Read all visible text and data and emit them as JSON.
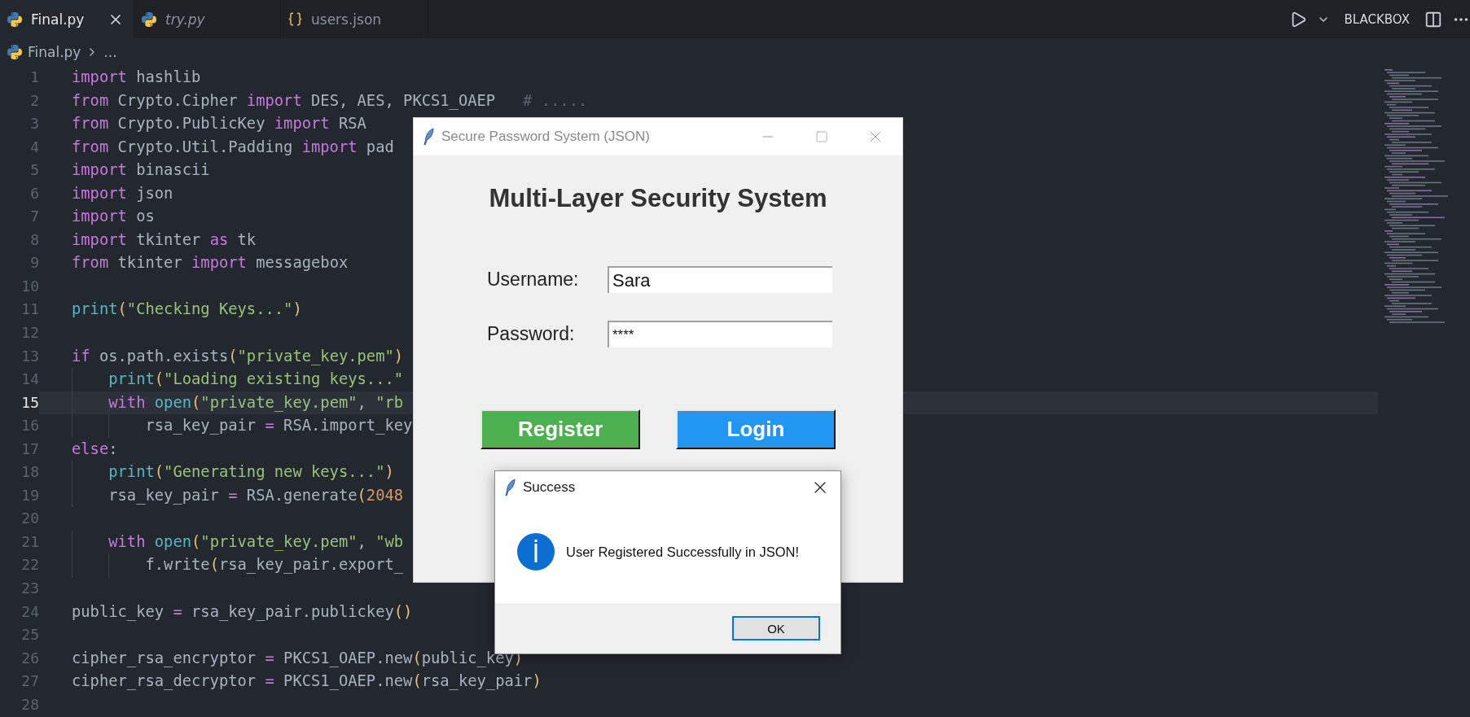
{
  "tabs": [
    {
      "label": "Final.py",
      "kind": "python",
      "selected": true,
      "preview": false
    },
    {
      "label": "try.py",
      "kind": "python",
      "selected": false,
      "preview": true
    },
    {
      "label": "users.json",
      "kind": "json",
      "selected": false,
      "preview": false
    }
  ],
  "toolbar": {
    "label": "BLACKBOX"
  },
  "breadcrumb": [
    "Final.py",
    "..."
  ],
  "editor": {
    "lines": [
      {
        "number": "1",
        "current": false,
        "tokens": [
          {
            "kind": "kw",
            "text": "import"
          },
          {
            "kind": "plain",
            "text": " hashlib"
          }
        ]
      },
      {
        "number": "2",
        "current": false,
        "tokens": [
          {
            "kind": "kw",
            "text": "from"
          },
          {
            "kind": "plain",
            "text": " Crypto.Cipher "
          },
          {
            "kind": "kw",
            "text": "import"
          },
          {
            "kind": "plain",
            "text": " DES, AES, PKCS1_OAEP   "
          },
          {
            "kind": "comment",
            "text": "# ....."
          }
        ]
      },
      {
        "number": "3",
        "current": false,
        "tokens": [
          {
            "kind": "kw",
            "text": "from"
          },
          {
            "kind": "plain",
            "text": " Crypto.PublicKey "
          },
          {
            "kind": "kw",
            "text": "import"
          },
          {
            "kind": "plain",
            "text": " RSA"
          }
        ]
      },
      {
        "number": "4",
        "current": false,
        "tokens": [
          {
            "kind": "kw",
            "text": "from"
          },
          {
            "kind": "plain",
            "text": " Crypto.Util.Padding "
          },
          {
            "kind": "kw",
            "text": "import"
          },
          {
            "kind": "plain",
            "text": " pad"
          }
        ]
      },
      {
        "number": "5",
        "current": false,
        "tokens": [
          {
            "kind": "kw",
            "text": "import"
          },
          {
            "kind": "plain",
            "text": " binascii"
          }
        ]
      },
      {
        "number": "6",
        "current": false,
        "tokens": [
          {
            "kind": "kw",
            "text": "import"
          },
          {
            "kind": "plain",
            "text": " json"
          }
        ]
      },
      {
        "number": "7",
        "current": false,
        "tokens": [
          {
            "kind": "kw",
            "text": "import"
          },
          {
            "kind": "plain",
            "text": " os"
          }
        ]
      },
      {
        "number": "8",
        "current": false,
        "tokens": [
          {
            "kind": "kw",
            "text": "import"
          },
          {
            "kind": "plain",
            "text": " tkinter "
          },
          {
            "kind": "kw",
            "text": "as"
          },
          {
            "kind": "plain",
            "text": " tk"
          }
        ]
      },
      {
        "number": "9",
        "current": false,
        "tokens": [
          {
            "kind": "kw",
            "text": "from"
          },
          {
            "kind": "plain",
            "text": " tkinter "
          },
          {
            "kind": "kw",
            "text": "import"
          },
          {
            "kind": "plain",
            "text": " messagebox"
          }
        ]
      },
      {
        "number": "10",
        "current": false
      },
      {
        "number": "11",
        "current": false,
        "tokens": [
          {
            "kind": "func",
            "text": "print"
          },
          {
            "kind": "bracket",
            "text": "("
          },
          {
            "kind": "string",
            "text": "\"Checking Keys...\""
          },
          {
            "kind": "bracket",
            "text": ")"
          }
        ]
      },
      {
        "number": "12",
        "current": false
      },
      {
        "number": "13",
        "current": false,
        "tokens": [
          {
            "kind": "kw",
            "text": "if"
          },
          {
            "kind": "plain",
            "text": " os.path.exists"
          },
          {
            "kind": "bracket",
            "text": "("
          },
          {
            "kind": "string",
            "text": "\"private_key.pem\""
          },
          {
            "kind": "bracket",
            "text": ")"
          }
        ]
      },
      {
        "number": "14",
        "current": false,
        "tokens": [
          {
            "kind": "func",
            "text": "    print"
          },
          {
            "kind": "bracket",
            "text": "("
          },
          {
            "kind": "string",
            "text": "\"Loading existing keys...\""
          }
        ]
      },
      {
        "number": "15",
        "current": true,
        "tokens": [
          {
            "kind": "kw",
            "text": "    with"
          },
          {
            "kind": "func",
            "text": " open"
          },
          {
            "kind": "bracket",
            "text": "("
          },
          {
            "kind": "string",
            "text": "\"private_key.pem\""
          },
          {
            "kind": "plain",
            "text": ", "
          },
          {
            "kind": "string",
            "text": "\"rb"
          }
        ]
      },
      {
        "number": "16",
        "current": false,
        "tokens": [
          {
            "kind": "plain",
            "text": "        rsa_key_pair "
          },
          {
            "kind": "op",
            "text": "="
          },
          {
            "kind": "plain",
            "text": " RSA.import_key"
          }
        ]
      },
      {
        "number": "17",
        "current": false,
        "tokens": [
          {
            "kind": "kw",
            "text": "else"
          },
          {
            "kind": "plain",
            "text": ":"
          }
        ]
      },
      {
        "number": "18",
        "current": false,
        "tokens": [
          {
            "kind": "func",
            "text": "    print"
          },
          {
            "kind": "bracket",
            "text": "("
          },
          {
            "kind": "string",
            "text": "\"Generating new keys...\""
          },
          {
            "kind": "bracket",
            "text": ")"
          }
        ]
      },
      {
        "number": "19",
        "current": false,
        "tokens": [
          {
            "kind": "plain",
            "text": "    rsa_key_pair "
          },
          {
            "kind": "op",
            "text": "="
          },
          {
            "kind": "plain",
            "text": " RSA.generate"
          },
          {
            "kind": "bracket",
            "text": "("
          },
          {
            "kind": "number",
            "text": "2048"
          }
        ]
      },
      {
        "number": "20",
        "current": false
      },
      {
        "number": "21",
        "current": false,
        "tokens": [
          {
            "kind": "kw",
            "text": "    with"
          },
          {
            "kind": "func",
            "text": " open"
          },
          {
            "kind": "bracket",
            "text": "("
          },
          {
            "kind": "string",
            "text": "\"private_key.pem\""
          },
          {
            "kind": "plain",
            "text": ", "
          },
          {
            "kind": "string",
            "text": "\"wb"
          }
        ]
      },
      {
        "number": "22",
        "current": false,
        "tokens": [
          {
            "kind": "plain",
            "text": "        f.write"
          },
          {
            "kind": "bracket",
            "text": "("
          },
          {
            "kind": "plain",
            "text": "rsa_key_pair.export_"
          }
        ]
      },
      {
        "number": "23",
        "current": false
      },
      {
        "number": "24",
        "current": false,
        "tokens": [
          {
            "kind": "plain",
            "text": "public_key "
          },
          {
            "kind": "op",
            "text": "="
          },
          {
            "kind": "plain",
            "text": " rsa_key_pair.publickey"
          },
          {
            "kind": "bracket",
            "text": "()"
          }
        ]
      },
      {
        "number": "25",
        "current": false
      },
      {
        "number": "26",
        "current": false,
        "tokens": [
          {
            "kind": "plain",
            "text": "cipher_rsa_encryptor "
          },
          {
            "kind": "op",
            "text": "="
          },
          {
            "kind": "plain",
            "text": " PKCS1_OAEP.new"
          },
          {
            "kind": "bracket",
            "text": "("
          },
          {
            "kind": "plain",
            "text": "public_key"
          },
          {
            "kind": "bracket",
            "text": ")"
          }
        ]
      },
      {
        "number": "27",
        "current": false,
        "tokens": [
          {
            "kind": "plain",
            "text": "cipher_rsa_decryptor "
          },
          {
            "kind": "op",
            "text": "="
          },
          {
            "kind": "plain",
            "text": " PKCS1_OAEP.new"
          },
          {
            "kind": "bracket",
            "text": "("
          },
          {
            "kind": "plain",
            "text": "rsa_key_pair"
          },
          {
            "kind": "bracket",
            "text": ")"
          }
        ]
      },
      {
        "number": "28",
        "current": false
      }
    ]
  },
  "tk_window": {
    "title": "Secure Password System (JSON)",
    "heading": "Multi-Layer Security System",
    "fields": [
      {
        "label": "Username:",
        "value": "Sara"
      },
      {
        "label": "Password:",
        "value": "****"
      }
    ],
    "buttons": [
      {
        "label": "Register",
        "color": "#4caf50"
      },
      {
        "label": "Login",
        "color": "#2196f3"
      }
    ]
  },
  "dialog": {
    "title": "Success",
    "message": "User Registered Successfully in JSON!",
    "button": "OK"
  }
}
